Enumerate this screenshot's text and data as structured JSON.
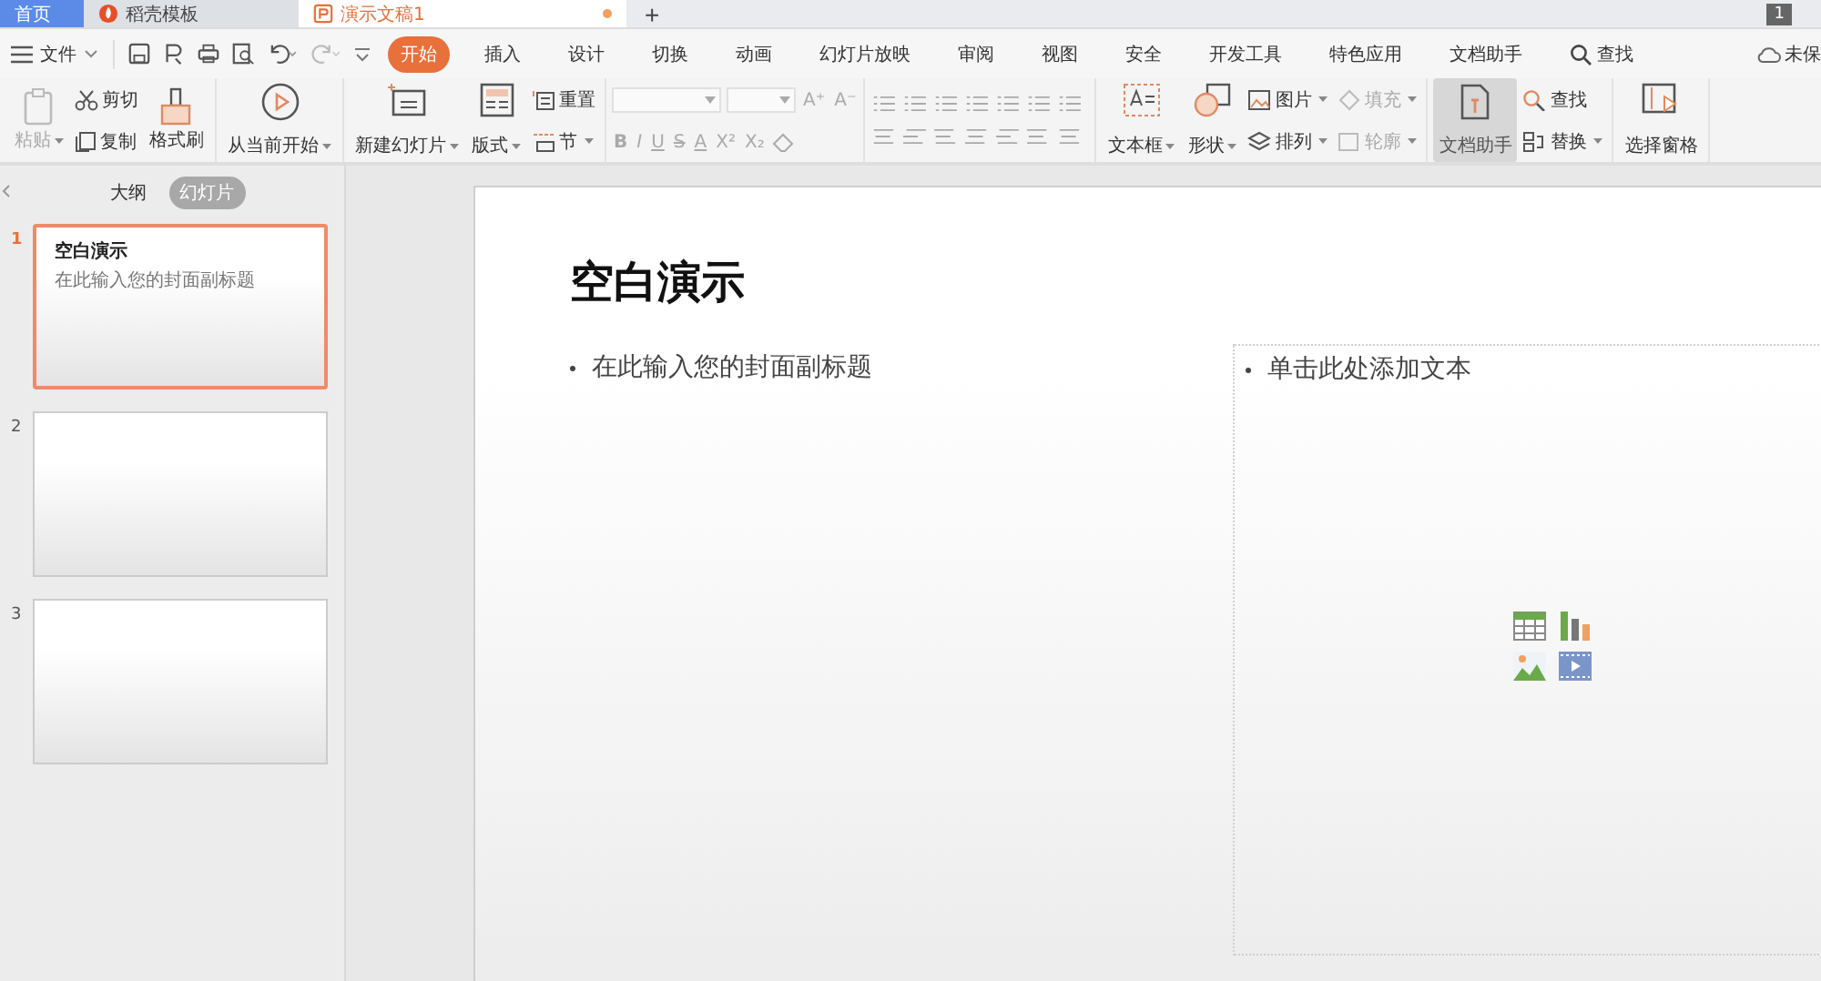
{
  "tabs": [
    {
      "label": "首页",
      "selected": false,
      "kind": "home"
    },
    {
      "label": "稻壳模板",
      "selected": false,
      "kind": "template"
    },
    {
      "label": "演示文稿1",
      "selected": true,
      "kind": "document",
      "unsaved": true
    }
  ],
  "new_tab": "+",
  "page_badge": "1",
  "file_menu": "文件",
  "menu_tabs": [
    {
      "label": "开始",
      "selected": true
    },
    {
      "label": "插入",
      "selected": false
    },
    {
      "label": "设计",
      "selected": false
    },
    {
      "label": "切换",
      "selected": false
    },
    {
      "label": "动画",
      "selected": false
    },
    {
      "label": "幻灯片放映",
      "selected": false
    },
    {
      "label": "审阅",
      "selected": false
    },
    {
      "label": "视图",
      "selected": false
    },
    {
      "label": "安全",
      "selected": false
    },
    {
      "label": "开发工具",
      "selected": false
    },
    {
      "label": "特色应用",
      "selected": false
    },
    {
      "label": "文档助手",
      "selected": false
    },
    {
      "label": "查找",
      "selected": false,
      "kind": "search"
    }
  ],
  "cloud_status": "未保",
  "ribbon": {
    "paste": {
      "label": "粘贴",
      "disabled": true
    },
    "cut": "剪切",
    "copy": "复制",
    "format_painter": "格式刷",
    "play_from_current": "从当前开始",
    "new_slide": "新建幻灯片",
    "layout": "版式",
    "reset": "重置",
    "section": "节",
    "font_buttons": [
      "A⁺",
      "A⁻",
      "B",
      "I",
      "U",
      "S",
      "A",
      "X²",
      "X₂"
    ],
    "text_box": "文本框",
    "shape": "形状",
    "picture": "图片",
    "fill": {
      "label": "填充",
      "disabled": true
    },
    "arrange": "排列",
    "outline": {
      "label": "轮廓",
      "disabled": true
    },
    "doc_assistant": {
      "label": "文档助手",
      "selected": true
    },
    "find": "查找",
    "replace": "替换",
    "selection_pane": "选择窗格"
  },
  "view_tabs": [
    {
      "label": "大纲",
      "selected": false
    },
    {
      "label": "幻灯片",
      "selected": true
    }
  ],
  "slides": [
    {
      "number": "1",
      "selected": true,
      "title": "空白演示",
      "subtitle": "在此输入您的封面副标题"
    },
    {
      "number": "2",
      "selected": false
    },
    {
      "number": "3",
      "selected": false
    }
  ],
  "slide": {
    "title": "空白演示",
    "subtitle": "在此输入您的封面副标题",
    "content_placeholder": "单击此处添加文本"
  }
}
